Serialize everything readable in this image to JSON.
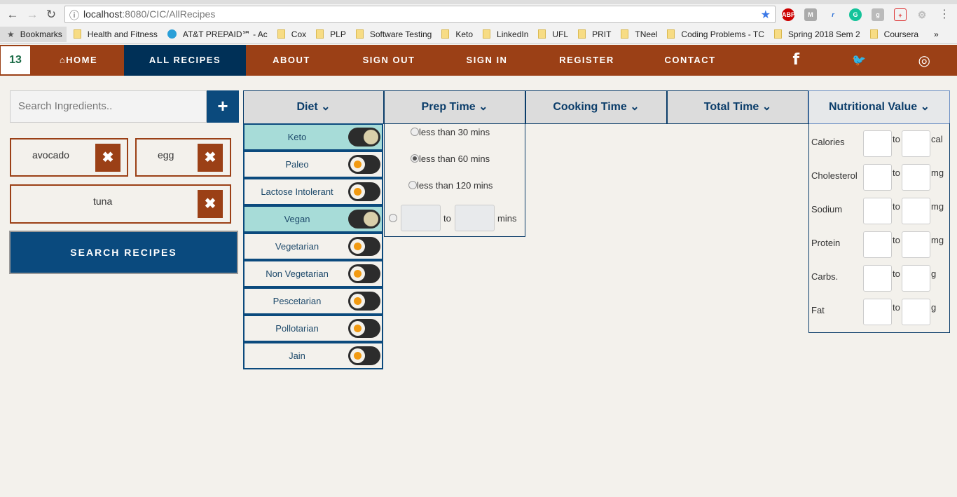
{
  "browser": {
    "url_host": "localhost",
    "url_rest": ":8080/CIC/AllRecipes",
    "bookmarks_label": "Bookmarks",
    "bookmarks": [
      "Health and Fitness",
      "AT&T PREPAID℠ - Ac",
      "Cox",
      "PLP",
      "Software Testing",
      "Keto",
      "LinkedIn",
      "UFL",
      "PRIT",
      "TNeel",
      "Coding Problems - TC",
      "Spring 2018 Sem 2",
      "Coursera"
    ],
    "more": "»",
    "extensions": [
      "ABP",
      "M",
      "r",
      "G",
      "g",
      "+",
      "⚙"
    ]
  },
  "nav": {
    "logo": "13",
    "home": "HOME",
    "all_recipes": "ALL RECIPES",
    "about": "ABOUT",
    "sign_out": "SIGN OUT",
    "sign_in": "SIGN IN",
    "register": "REGISTER",
    "contact": "CONTACT",
    "facebook": "f",
    "twitter": "🐦",
    "instagram": "◎"
  },
  "search": {
    "placeholder": "Search Ingredients..",
    "add": "+",
    "chips": [
      "avocado",
      "egg",
      "tuna"
    ],
    "remove": "✖",
    "submit": "SEARCH RECIPES"
  },
  "filters": {
    "diet": "Diet",
    "prep": "Prep Time",
    "cooking": "Cooking Time",
    "total": "Total Time",
    "nutrition": "Nutritional Value",
    "chevron": "⌄"
  },
  "diet_options": [
    {
      "label": "Keto",
      "on": true
    },
    {
      "label": "Paleo",
      "on": false
    },
    {
      "label": "Lactose Intolerant",
      "on": false
    },
    {
      "label": "Vegan",
      "on": true
    },
    {
      "label": "Vegetarian",
      "on": false
    },
    {
      "label": "Non Vegetarian",
      "on": false
    },
    {
      "label": "Pescetarian",
      "on": false
    },
    {
      "label": "Pollotarian",
      "on": false
    },
    {
      "label": "Jain",
      "on": false
    }
  ],
  "prep_options": {
    "o1": "less than 30 mins",
    "o2": "less than 60 mins",
    "o3": "less than 120 mins",
    "to": "to",
    "mins": "mins",
    "selected": "less than 60 mins"
  },
  "nutrients": [
    {
      "name": "Calories",
      "unit": "cal"
    },
    {
      "name": "Cholesterol",
      "unit": "mg"
    },
    {
      "name": "Sodium",
      "unit": "mg"
    },
    {
      "name": "Protein",
      "unit": "mg"
    },
    {
      "name": "Carbs.",
      "unit": "g"
    },
    {
      "name": "Fat",
      "unit": "g"
    }
  ],
  "nutr_to": "to"
}
